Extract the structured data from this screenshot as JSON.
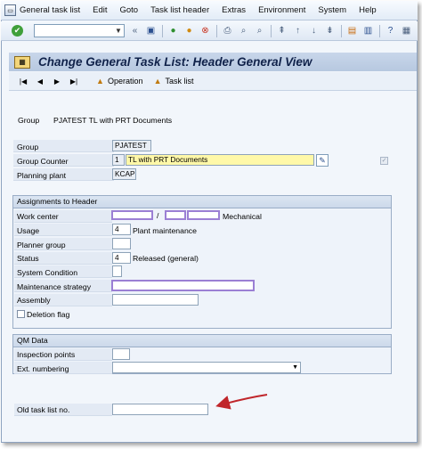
{
  "menu": {
    "items": [
      "General task list",
      "Edit",
      "Goto",
      "Task list header",
      "Extras",
      "Environment",
      "System",
      "Help"
    ]
  },
  "toolbar": {
    "icons": [
      "save-icon",
      "back-icon",
      "exit-icon",
      "cancel-icon",
      "print-icon",
      "find-icon",
      "find-next-icon",
      "first-page-icon",
      "prev-page-icon",
      "next-page-icon",
      "last-page-icon",
      "new-session-icon",
      "shortcut-icon",
      "help-icon",
      "layout-icon"
    ],
    "command_value": ""
  },
  "title": {
    "text": "Change General Task List: Header General View"
  },
  "app_toolbar": {
    "nav": [
      "|◀",
      "◀",
      "▶",
      "▶|"
    ],
    "operation_label": "Operation",
    "task_list_label": "Task list"
  },
  "header": {
    "group_label": "Group",
    "group_value": "PJATEST  TL with PRT Documents"
  },
  "fields": {
    "group_label": "Group",
    "group_value": "PJATEST",
    "group_counter_label": "Group Counter",
    "group_counter_value": "1",
    "group_counter_text": "TL with PRT Documents",
    "planning_plant_label": "Planning plant",
    "planning_plant_value": "KCAP"
  },
  "assignments": {
    "title": "Assignments to Header",
    "work_center_label": "Work center",
    "work_center_sep": "/",
    "work_center_text": "Mechanical",
    "usage_label": "Usage",
    "usage_value": "4",
    "usage_text": "Plant maintenance",
    "planner_group_label": "Planner group",
    "planner_group_value": "",
    "status_label": "Status",
    "status_value": "4",
    "status_text": "Released (general)",
    "system_condition_label": "System Condition",
    "system_condition_value": "",
    "maintenance_strategy_label": "Maintenance strategy",
    "assembly_label": "Assembly",
    "assembly_value": "",
    "deletion_flag_label": "Deletion flag"
  },
  "qm": {
    "title": "QM Data",
    "inspection_points_label": "Inspection points",
    "inspection_points_value": "",
    "ext_numbering_label": "Ext. numbering",
    "ext_numbering_value": ""
  },
  "old_task_list": {
    "label": "Old task list no.",
    "value": ""
  },
  "colors": {
    "annotation_arrow": "#c0262b",
    "redaction_border": "#9b7fd4",
    "highlight_field": "#fff8a8"
  }
}
